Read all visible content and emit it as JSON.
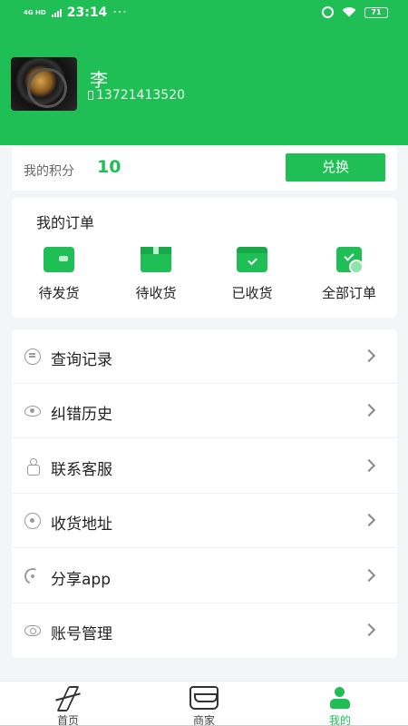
{
  "status_bar": {
    "network": "4G HD",
    "time": "23:14",
    "more": "···",
    "battery": "71"
  },
  "profile": {
    "name": "李",
    "phone": "13721413520"
  },
  "points": {
    "label": "我的积分",
    "value": "10",
    "redeem_label": "兑换"
  },
  "orders": {
    "title": "我的订单",
    "items": [
      {
        "label": "待发货",
        "icon": "wallet-icon"
      },
      {
        "label": "待收货",
        "icon": "box-icon"
      },
      {
        "label": "已收货",
        "icon": "received-icon"
      },
      {
        "label": "全部订单",
        "icon": "all-orders-icon"
      }
    ]
  },
  "menu": {
    "items": [
      {
        "label": "查询记录",
        "icon": "chat-icon"
      },
      {
        "label": "纠错历史",
        "icon": "eye-icon"
      },
      {
        "label": "联系客服",
        "icon": "customer-service-icon"
      },
      {
        "label": "收货地址",
        "icon": "location-icon"
      },
      {
        "label": "分享app",
        "icon": "share-icon"
      },
      {
        "label": "账号管理",
        "icon": "account-icon"
      }
    ]
  },
  "bottom_nav": {
    "items": [
      {
        "label": "首页",
        "icon": "home-icon"
      },
      {
        "label": "商家",
        "icon": "shop-icon"
      },
      {
        "label": "我的",
        "icon": "profile-icon",
        "active": true
      }
    ]
  },
  "colors": {
    "brand_green": "#1fbf55",
    "background": "#f4f5f7"
  }
}
